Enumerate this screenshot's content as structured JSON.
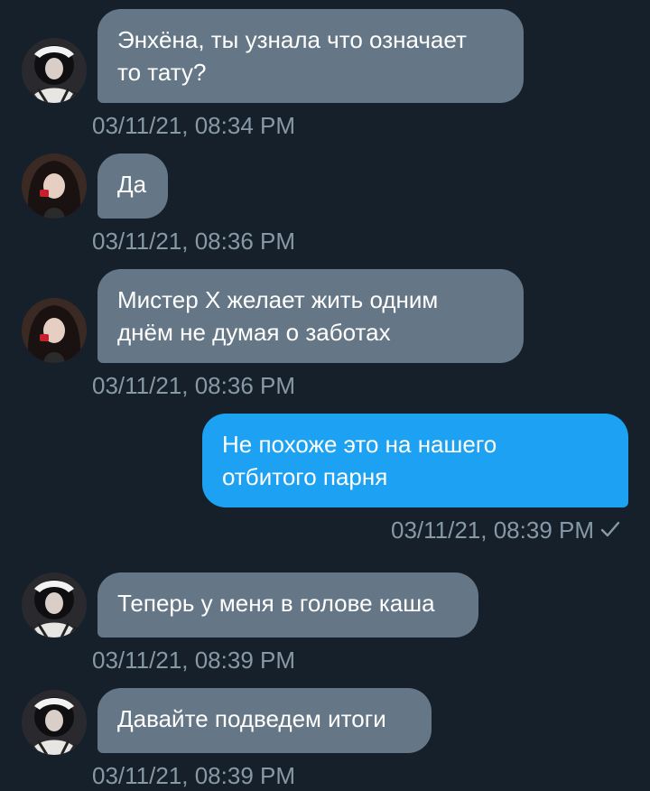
{
  "messages": [
    {
      "direction": "in",
      "avatar": "avatar-1",
      "text": "Энхёна, ты узнала что означает\nто тату?",
      "time": "03/11/21, 08:34 PM"
    },
    {
      "direction": "in",
      "avatar": "avatar-2",
      "text": "Да",
      "time": "03/11/21, 08:36 PM"
    },
    {
      "direction": "in",
      "avatar": "avatar-2",
      "text": "Мистер Х желает жить одним\nднём не думая о заботах",
      "time": "03/11/21, 08:36 PM"
    },
    {
      "direction": "out",
      "text": "Не похоже это на нашего\nотбитого парня",
      "time": "03/11/21, 08:39 PM",
      "status_icon": "checkmark-icon"
    },
    {
      "direction": "in",
      "avatar": "avatar-1",
      "text": "Теперь у меня в голове каша",
      "time": "03/11/21, 08:39 PM"
    },
    {
      "direction": "in",
      "avatar": "avatar-1",
      "text": "Давайте подведем итоги",
      "time": "03/11/21, 08:39 PM"
    }
  ],
  "colors": {
    "background": "#15202b",
    "incoming_bubble": "#657786",
    "outgoing_bubble": "#1da1f2",
    "timestamp": "#8899a6",
    "text": "#ffffff"
  }
}
